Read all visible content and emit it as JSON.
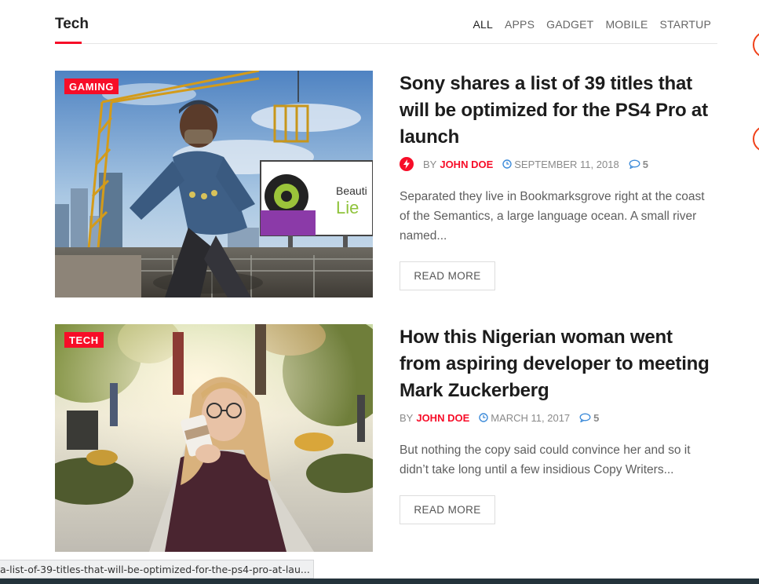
{
  "section": {
    "title": "Tech",
    "tabs": [
      {
        "label": "ALL",
        "active": true
      },
      {
        "label": "APPS",
        "active": false
      },
      {
        "label": "GADGET",
        "active": false
      },
      {
        "label": "MOBILE",
        "active": false
      },
      {
        "label": "STARTUP",
        "active": false
      }
    ]
  },
  "articles": [
    {
      "category": "GAMING",
      "title": "Sony shares a list of 39 titles that will be optimized for the PS4 Pro at launch",
      "by": "BY",
      "author": "JOHN DOE",
      "date": "SEPTEMBER 11, 2018",
      "comments": "5",
      "excerpt": "Separated they live in Bookmarksgrove right at the coast of the Semantics, a large language ocean. A small river named...",
      "read_more": "READ MORE",
      "image": "video-game-character-construction-site",
      "image_billboard_text": "Beauti"
    },
    {
      "category": "TECH",
      "title": "How this Nigerian woman went from aspiring developer to meeting Mark Zuckerberg",
      "by": "BY",
      "author": "JOHN DOE",
      "date": "MARCH 11, 2017",
      "comments": "5",
      "excerpt": "But nothing the copy said could convince her and so it didn’t take long until a few insidious Copy Writers...",
      "read_more": "READ MORE",
      "image": "woman-drinking-coffee-park"
    }
  ],
  "status_bar": {
    "url": "a-list-of-39-titles-that-will-be-optimized-for-the-ps4-pro-at-lau..."
  },
  "colors": {
    "accent": "#f70d28",
    "text_dark": "#1c1c1c",
    "text_muted": "#8a8a8a",
    "date_icon": "#3d8bd9"
  }
}
